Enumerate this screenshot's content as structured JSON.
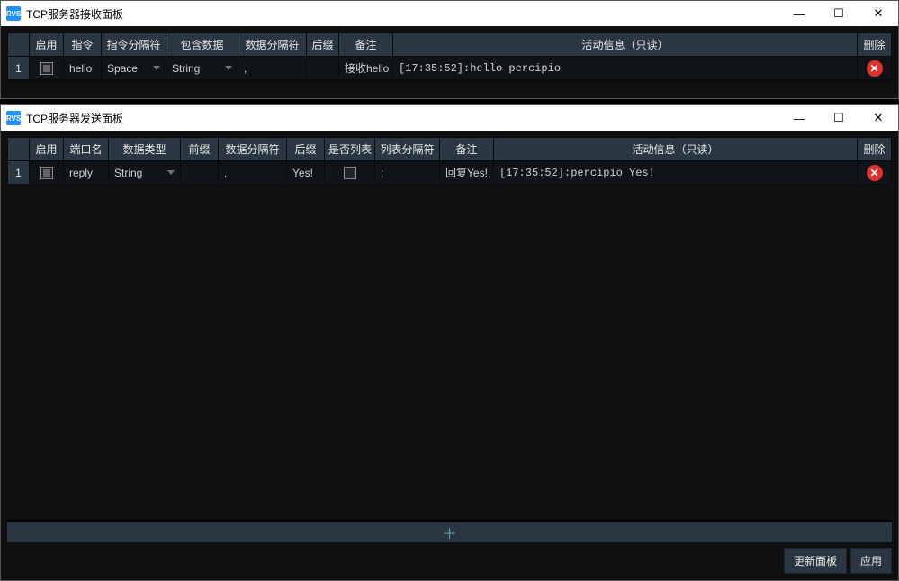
{
  "windows": {
    "recv": {
      "title": "TCP服务器接收面板",
      "icon_text": "RVS",
      "headers": {
        "rownum": "",
        "enable": "启用",
        "cmd": "指令",
        "cmd_sep": "指令分隔符",
        "contain_data": "包含数据",
        "data_sep": "数据分隔符",
        "suffix": "后缀",
        "remark": "备注",
        "activity": "活动信息（只读）",
        "delete": "删除"
      },
      "rows": [
        {
          "idx": "1",
          "cmd": "hello",
          "cmd_sep": "Space",
          "contain_data": "String",
          "data_sep": ",",
          "suffix": "",
          "remark": "接收hello",
          "activity": "[17:35:52]:hello percipio"
        }
      ]
    },
    "send": {
      "title": "TCP服务器发送面板",
      "icon_text": "RVS",
      "headers": {
        "rownum": "",
        "enable": "启用",
        "port": "端口名",
        "dtype": "数据类型",
        "prefix": "前缀",
        "data_sep": "数据分隔符",
        "suffix": "后缀",
        "is_list": "是否列表",
        "list_sep": "列表分隔符",
        "remark": "备注",
        "activity": "活动信息（只读）",
        "delete": "删除"
      },
      "rows": [
        {
          "idx": "1",
          "port": "reply",
          "dtype": "String",
          "prefix": "",
          "data_sep": ",",
          "suffix": "Yes!",
          "is_list_checked": false,
          "list_sep": ";",
          "remark": "回复Yes!",
          "activity": "[17:35:52]:percipio Yes!"
        }
      ],
      "footer": {
        "refresh": "更新面板",
        "apply": "应用"
      },
      "add_label": "＋"
    }
  }
}
